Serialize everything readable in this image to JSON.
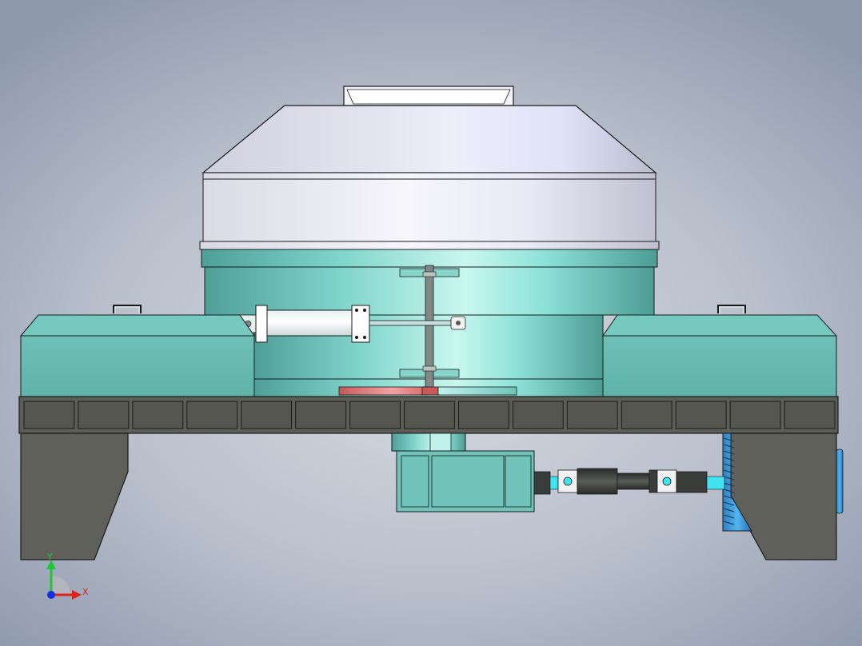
{
  "viewport": {
    "background_top": "#8f9aac",
    "background_center": "#d6dae2"
  },
  "model": {
    "colors": {
      "housing_white": "#eceef8",
      "teal": "#6fc3b9",
      "teal_light": "#bff2ea",
      "frame_gray": "#5f605a",
      "beam_dark": "#55564f",
      "rotary_blue": "#3aa8e6",
      "coupling_dark": "#3a3c3a",
      "cyan_accent": "#41e3f0",
      "seal_red": "#d76a6a",
      "outline": "#1a1a1a"
    },
    "icons": {
      "triad": "coordinate-triad-icon"
    }
  },
  "triad": {
    "y_label": "Y",
    "x_label": "X",
    "y_color": "#22c43a",
    "x_color": "#e0201a",
    "origin_color": "#1530e0"
  }
}
